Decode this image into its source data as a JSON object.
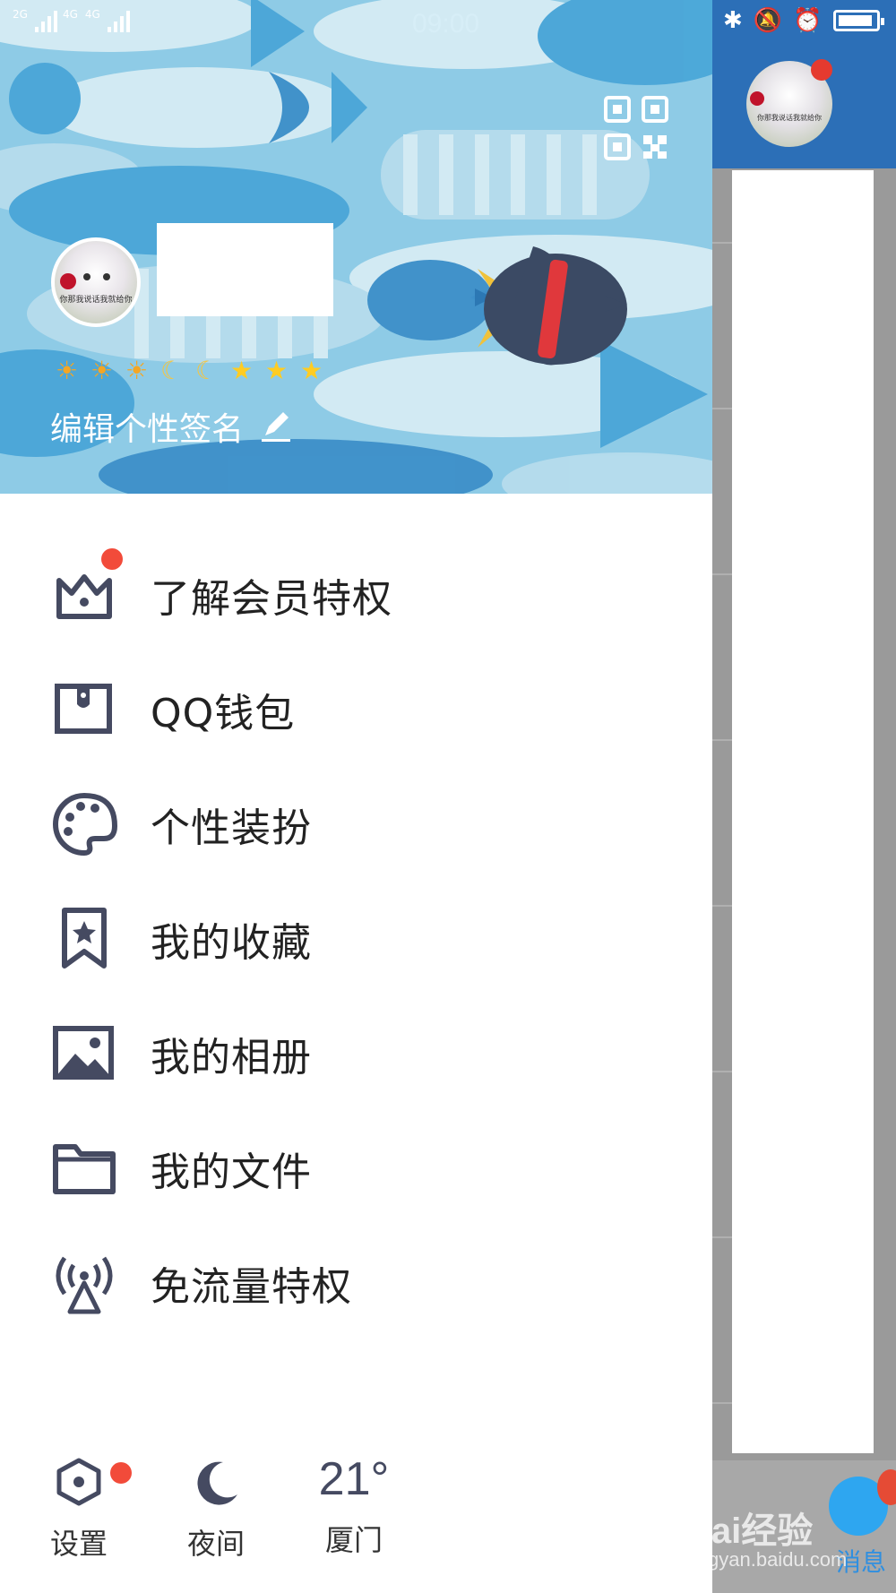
{
  "status_bar": {
    "network_1": "2G",
    "network_2": "4G",
    "network_3": "4G",
    "time": "09:00"
  },
  "profile": {
    "avatar_caption": "你那我说话我就给你",
    "level_icons": [
      "sun",
      "sun",
      "sun",
      "moon",
      "moon",
      "star",
      "star",
      "star"
    ],
    "signature": "编辑个性签名"
  },
  "menu": {
    "items": [
      {
        "label": "了解会员特权",
        "icon": "crown-icon",
        "has_badge": true
      },
      {
        "label": "QQ钱包",
        "icon": "wallet-icon",
        "has_badge": false
      },
      {
        "label": "个性装扮",
        "icon": "palette-icon",
        "has_badge": false
      },
      {
        "label": "我的收藏",
        "icon": "bookmark-icon",
        "has_badge": false
      },
      {
        "label": "我的相册",
        "icon": "photo-album-icon",
        "has_badge": false
      },
      {
        "label": "我的文件",
        "icon": "folder-icon",
        "has_badge": false
      },
      {
        "label": "免流量特权",
        "icon": "signal-tower-icon",
        "has_badge": false
      }
    ]
  },
  "bottom_bar": {
    "settings_label": "设置",
    "night_label": "夜间",
    "weather_temp": "21°",
    "weather_city": "厦门"
  },
  "right_panel": {
    "messages_label": "消息"
  },
  "watermark": {
    "brand": "Bai经验",
    "url": "jingyan.baidu.com"
  },
  "colors": {
    "accent_red": "#f24b3a",
    "icon_gray": "#454a61",
    "header_blue": "#8ecbe6",
    "right_header_blue": "#2c6fb7"
  }
}
